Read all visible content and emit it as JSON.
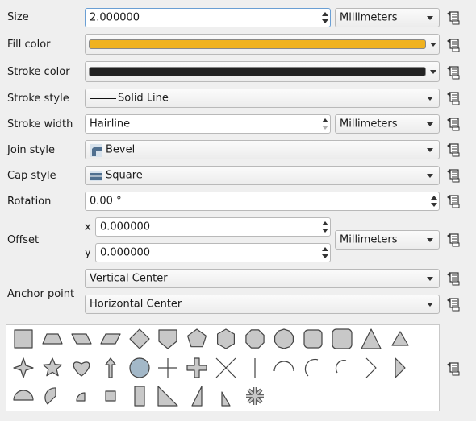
{
  "labels": {
    "size": "Size",
    "fill_color": "Fill color",
    "stroke_color": "Stroke color",
    "stroke_style": "Stroke style",
    "stroke_width": "Stroke width",
    "join_style": "Join style",
    "cap_style": "Cap style",
    "rotation": "Rotation",
    "offset": "Offset",
    "offset_x": "x",
    "offset_y": "y",
    "anchor_point": "Anchor point"
  },
  "values": {
    "size": "2.000000",
    "size_unit": "Millimeters",
    "stroke_style": "Solid Line",
    "stroke_width": "Hairline",
    "stroke_width_unit": "Millimeters",
    "join_style": "Bevel",
    "cap_style": "Square",
    "rotation": "0.00 °",
    "offset_x": "0.000000",
    "offset_y": "0.000000",
    "offset_unit": "Millimeters",
    "anchor_vertical": "Vertical Center",
    "anchor_horizontal": "Horizontal Center"
  },
  "colors": {
    "fill_color": "#f0b21f",
    "stroke_color": "#222222",
    "shape_fill": "#c8c8c8",
    "circle_selected": "#a3b8c8"
  },
  "icons": {
    "data_defined": "data-defined-override-icon"
  },
  "shapes": [
    "square",
    "trapezoid",
    "parallelogram",
    "parallelogram-right",
    "diamond",
    "shield",
    "pentagon",
    "hexagon",
    "octagon",
    "decagon",
    "rounded-square",
    "rounded-square-large",
    "triangle",
    "equilateral-triangle",
    "star-diamond",
    "star",
    "heart",
    "arrow",
    "circle",
    "cross",
    "cross-fill",
    "x",
    "line",
    "arc-half",
    "arc-quarter",
    "arc-third",
    "arrowhead",
    "filled-arrowhead",
    "semi-circle",
    "third-circle",
    "quarter-circle",
    "small-square",
    "rectangle",
    "right-half-triangle",
    "left-half-triangle",
    "quarter-triangle",
    "asterisk"
  ]
}
